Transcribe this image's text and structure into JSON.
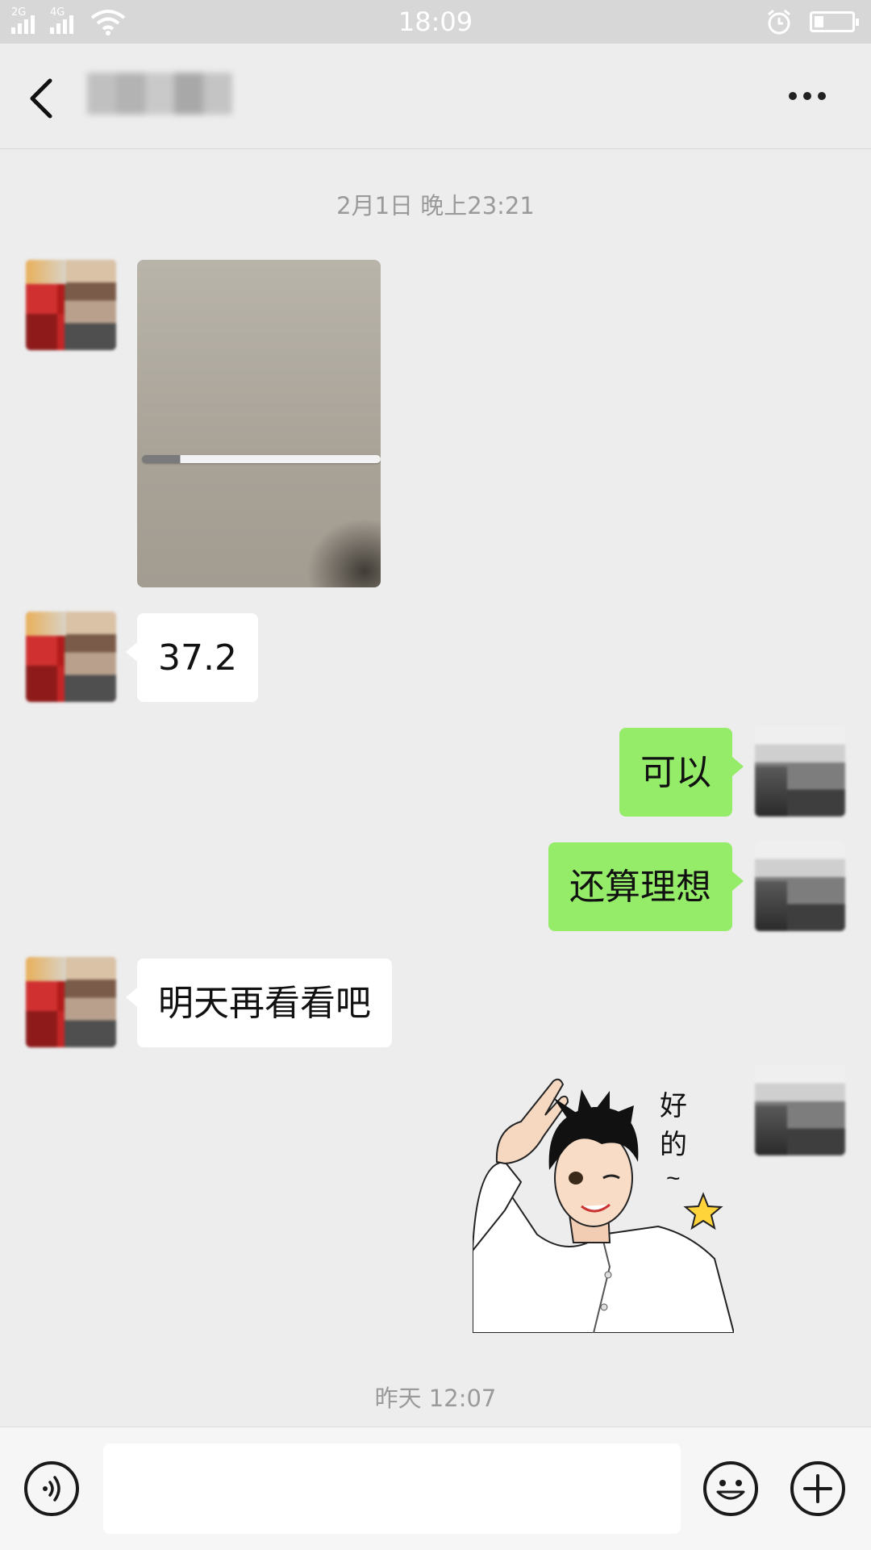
{
  "status_bar": {
    "network_1": "2G",
    "network_2": "4G",
    "time": "18:09",
    "battery_level": 0.25
  },
  "nav": {
    "back_icon": "chevron-left-icon",
    "more_icon": "more-dots-icon"
  },
  "chat": {
    "timestamp_1": "2月1日 晚上23:21",
    "msg_temp": "37.2",
    "msg_ok": "可以",
    "msg_ideal": "还算理想",
    "msg_tomorrow": "明天再看看吧",
    "sticker_text": "好的~",
    "timestamp_2": "昨天 12:07"
  },
  "input_bar": {
    "voice_icon": "voice-icon",
    "emoji_icon": "emoji-icon",
    "plus_icon": "plus-icon",
    "text_value": ""
  }
}
